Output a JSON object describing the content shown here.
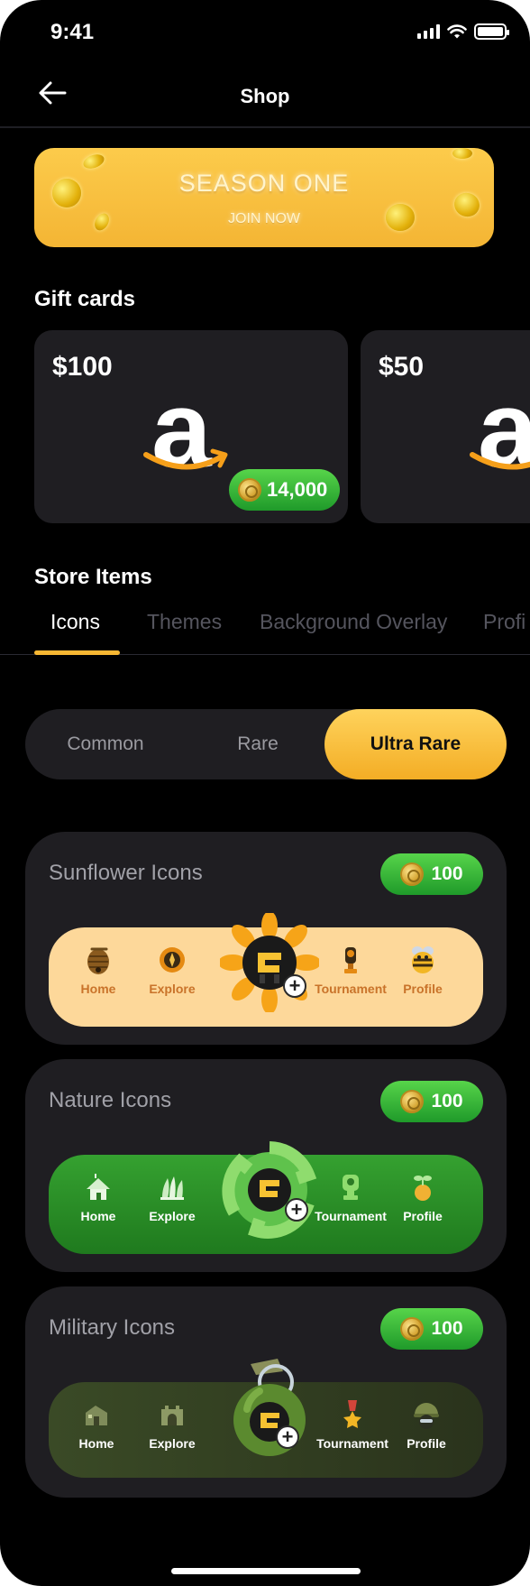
{
  "status_bar": {
    "time": "9:41"
  },
  "header": {
    "title": "Shop",
    "back_icon": "arrow-left-icon"
  },
  "banner": {
    "title": "SEASON ONE",
    "subtitle": "JOIN NOW"
  },
  "gift_cards": {
    "section_title": "Gift cards",
    "cards": [
      {
        "amount": "$100",
        "brand_letter": "a",
        "price": "14,000"
      },
      {
        "amount": "$50",
        "brand_letter": "a"
      }
    ]
  },
  "store": {
    "section_title": "Store Items",
    "tabs": [
      "Icons",
      "Themes",
      "Background Overlay",
      "Profi"
    ],
    "active_tab": "Icons",
    "rarity": {
      "options": [
        "Common",
        "Rare",
        "Ultra Rare"
      ],
      "selected": "Ultra Rare"
    }
  },
  "packs": [
    {
      "title": "Sunflower Icons",
      "price": "100",
      "bar_color": "#fdd89a",
      "labels": {
        "home": "Home",
        "explore": "Explore",
        "tournament": "Tournament",
        "profile": "Profile"
      }
    },
    {
      "title": "Nature Icons",
      "price": "100",
      "bar_color": "#2f8f2a",
      "labels": {
        "home": "Home",
        "explore": "Explore",
        "tournament": "Tournament",
        "profile": "Profile"
      }
    },
    {
      "title": "Military Icons",
      "price": "100",
      "bar_color": "#2f3a21",
      "labels": {
        "home": "Home",
        "explore": "Explore",
        "tournament": "Tournament",
        "profile": "Profile"
      }
    }
  ],
  "colors": {
    "accent": "#f7b733",
    "green": "#2fa83a",
    "card_bg": "#1f1e22",
    "background": "#000000"
  }
}
